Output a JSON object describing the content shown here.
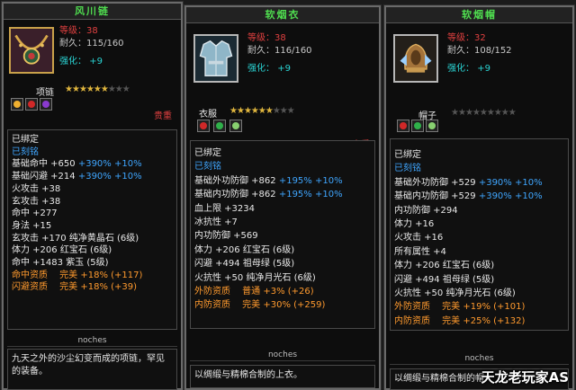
{
  "items": [
    {
      "title": "风川链",
      "level_label": "等级：",
      "level": "38",
      "durability_label": "耐久：",
      "durability": "115/160",
      "enhance_label": "强化：",
      "enhance": "+9",
      "type": "项链",
      "stars_on": 6,
      "stars_total": 9,
      "price_label": "贵重",
      "lines": [
        [
          [
            "已绑定",
            "w"
          ]
        ],
        [
          [
            "已刻铭",
            "b"
          ]
        ],
        [
          [
            "基础命中 +650 ",
            "w"
          ],
          [
            "+390% +10%",
            "b"
          ]
        ],
        [
          [
            "基础闪避 +214 ",
            "w"
          ],
          [
            "+390% +10%",
            "b"
          ]
        ],
        [
          [
            "火攻击 +38",
            "w"
          ]
        ],
        [
          [
            "玄攻击 +38",
            "w"
          ]
        ],
        [
          [
            "命中 +277",
            "w"
          ]
        ],
        [
          [
            "身法 +15",
            "w"
          ]
        ],
        [
          [
            "玄攻击 +170 ",
            "w"
          ],
          [
            "纯净黄晶石 (6级)",
            "w"
          ]
        ],
        [
          [
            "体力 +206 ",
            "w"
          ],
          [
            "红宝石 (6级)",
            "w"
          ]
        ],
        [
          [
            "命中 +1483 ",
            "w"
          ],
          [
            "紫玉 (5级)",
            "w"
          ]
        ],
        [
          [
            "命中资质　 完美 +18% (+117)",
            "o"
          ]
        ],
        [
          [
            "闪避资质　 完美 +18% (+39)",
            "o"
          ]
        ]
      ],
      "footer": "noches",
      "description": "九天之外的沙尘幻变而成的项链，罕见的装备。"
    },
    {
      "title": "软烟衣",
      "level_label": "等级：",
      "level": "38",
      "durability_label": "耐久：",
      "durability": "116/160",
      "enhance_label": "强化：",
      "enhance": "+9",
      "type": "衣服",
      "stars_on": 6,
      "stars_total": 9,
      "price_label": "贵重",
      "lines": [
        [
          [
            "已绑定",
            "w"
          ]
        ],
        [
          [
            "已刻铭",
            "b"
          ]
        ],
        [
          [
            "基础外功防御 +862 ",
            "w"
          ],
          [
            "+195% +10%",
            "b"
          ]
        ],
        [
          [
            "基础内功防御 +862 ",
            "w"
          ],
          [
            "+195% +10%",
            "b"
          ]
        ],
        [
          [
            "血上限 +3234",
            "w"
          ]
        ],
        [
          [
            "冰抗性 +7",
            "w"
          ]
        ],
        [
          [
            "内功防御 +569",
            "w"
          ]
        ],
        [
          [
            "体力 +206 ",
            "w"
          ],
          [
            "红宝石 (6级)",
            "w"
          ]
        ],
        [
          [
            "闪避 +494 ",
            "w"
          ],
          [
            "祖母绿 (5级)",
            "w"
          ]
        ],
        [
          [
            "火抗性 +50 ",
            "w"
          ],
          [
            "纯净月光石 (6级)",
            "w"
          ]
        ],
        [
          [
            "外防资质　 普通 +3% (+26)",
            "o"
          ]
        ],
        [
          [
            "内防资质　 完美 +30% (+259)",
            "o"
          ]
        ]
      ],
      "footer": "noches",
      "description": "以绸缎与精棉合制的上衣。"
    },
    {
      "title": "软烟帽",
      "level_label": "等级：",
      "level": "32",
      "durability_label": "耐久：",
      "durability": "108/152",
      "enhance_label": "强化：",
      "enhance": "+9",
      "type": "帽子",
      "stars_on": 0,
      "stars_total": 9,
      "price_label": "贵重",
      "lines": [
        [
          [
            "已绑定",
            "w"
          ]
        ],
        [
          [
            "已刻铭",
            "b"
          ]
        ],
        [
          [
            "基础外功防御 +529 ",
            "w"
          ],
          [
            "+390% +10%",
            "b"
          ]
        ],
        [
          [
            "基础内功防御 +529 ",
            "w"
          ],
          [
            "+390% +10%",
            "b"
          ]
        ],
        [
          [
            "内功防御 +294",
            "w"
          ]
        ],
        [
          [
            "体力 +16",
            "w"
          ]
        ],
        [
          [
            "火攻击 +16",
            "w"
          ]
        ],
        [
          [
            "所有属性 +4",
            "w"
          ]
        ],
        [
          [
            "体力 +206 ",
            "w"
          ],
          [
            "红宝石 (6级)",
            "w"
          ]
        ],
        [
          [
            "闪避 +494 ",
            "w"
          ],
          [
            "祖母绿 (5级)",
            "w"
          ]
        ],
        [
          [
            "火抗性 +50 ",
            "w"
          ],
          [
            "纯净月光石 (6级)",
            "w"
          ]
        ],
        [
          [
            "外防资质　 完美 +19% (+101)",
            "o"
          ]
        ],
        [
          [
            "内防资质　 完美 +25% (+132)",
            "o"
          ]
        ]
      ],
      "footer": "noches",
      "description": "以绸缎与精棉合制的帽"
    }
  ],
  "watermark": "天龙老玩家AS",
  "colors": {
    "title": "#4fdc4f",
    "red": "#e04040",
    "cyan": "#2ad4d4",
    "blue": "#3fa6ff",
    "orange": "#ff9a2e",
    "star_on": "#e0b63e"
  }
}
